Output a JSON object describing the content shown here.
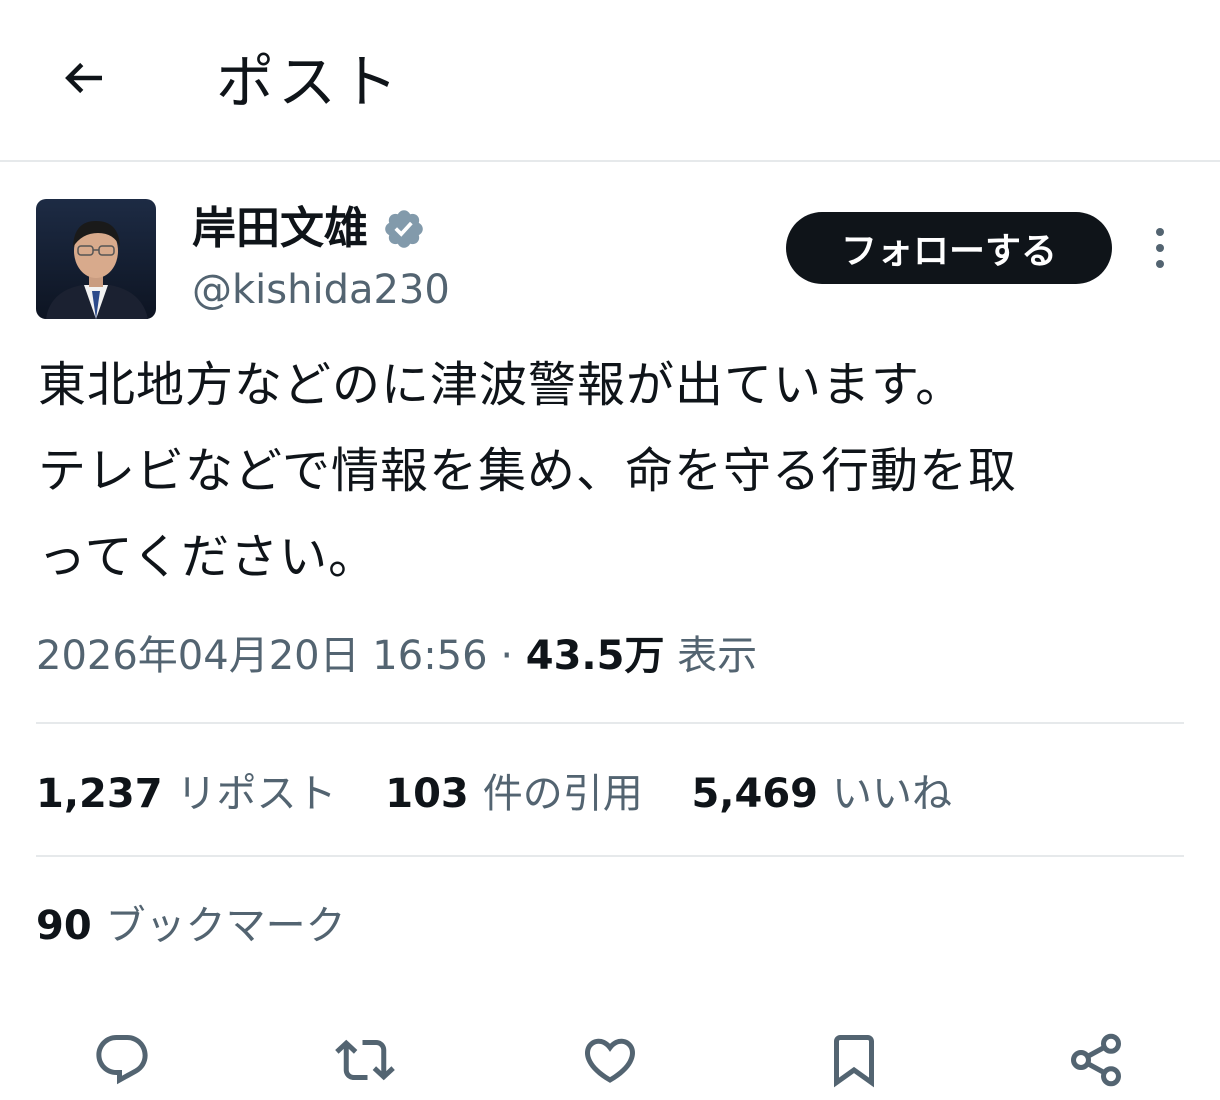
{
  "header": {
    "title": "ポスト",
    "back_icon": "back-arrow-icon"
  },
  "author": {
    "display_name": "岸田文雄",
    "handle": "@kishida230",
    "verified": true,
    "verified_color": "#829aab"
  },
  "follow_button": {
    "label": "フォローする"
  },
  "tweet": {
    "text": "東北地方などのに津波警報が出ています。\nテレビなどで情報を集め、命を守る行動を取\nってください。"
  },
  "meta": {
    "timestamp": "2026年04月20日 16:56",
    "separator": "·",
    "views_count": "43.5万",
    "views_label": "表示"
  },
  "stats": {
    "reposts": {
      "count": "1,237",
      "label": "リポスト"
    },
    "quotes": {
      "count": "103",
      "label": "件の引用"
    },
    "likes": {
      "count": "5,469",
      "label": "いいね"
    },
    "bookmarks": {
      "count": "90",
      "label": "ブックマーク"
    }
  },
  "actions": [
    "reply-icon",
    "repost-icon",
    "like-icon",
    "bookmark-icon",
    "share-icon"
  ],
  "colors": {
    "text": "#0f1419",
    "secondary": "#536471",
    "divider": "#e6e9eb",
    "button": "#0f1419"
  }
}
